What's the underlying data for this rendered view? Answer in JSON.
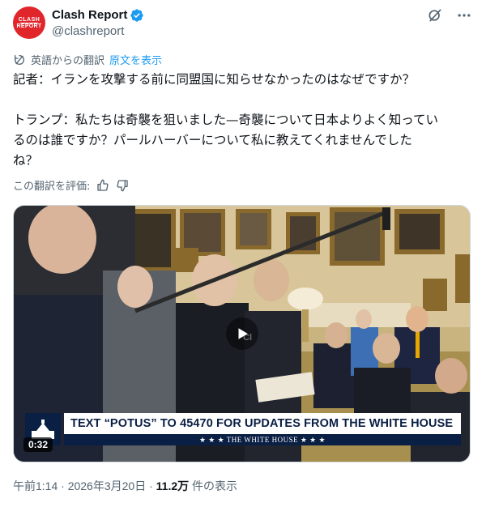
{
  "account": {
    "display_name": "Clash Report",
    "handle": "@clashreport",
    "avatar_line1": "CLASH",
    "avatar_line2": "REPORT"
  },
  "translation": {
    "label": "英語からの翻訳",
    "show_original": "原文を表示",
    "rate_label": "この翻訳を評価:"
  },
  "tweet": {
    "line1": "記者：イランを攻撃する前に同盟国に知らせなかったのはなぜですか？",
    "line2": "トランプ：私たちは奇襲を狙いました—奇襲について日本よりよく知ってい",
    "line3": "るのは誰ですか？パールハーバーについて私に教えてくれませんでした",
    "line4": "ね？"
  },
  "media": {
    "banner_text": "TEXT “POTUS” TO 45470 FOR UPDATES FROM THE WHITE HOUSE",
    "banner_sub": "★ ★ ★   THE WHITE HOUSE   ★ ★ ★",
    "duration": "0:32"
  },
  "meta": {
    "time": "午前1:14",
    "sep1": " · ",
    "date": "2026年3月20日",
    "sep2": " · ",
    "views": "11.2万",
    "views_suffix": " 件の表示"
  },
  "icons": {
    "verified": "verified-badge-icon",
    "grok": "grok-icon",
    "more": "more-icon",
    "translate": "translate-icon",
    "thumbs_up": "thumbs-up-icon",
    "thumbs_down": "thumbs-down-icon",
    "play": "play-icon"
  },
  "colors": {
    "accent": "#1d9bf0",
    "secondary_text": "#536471",
    "brand_red": "#e0252b",
    "banner_navy": "#0a1f44"
  }
}
